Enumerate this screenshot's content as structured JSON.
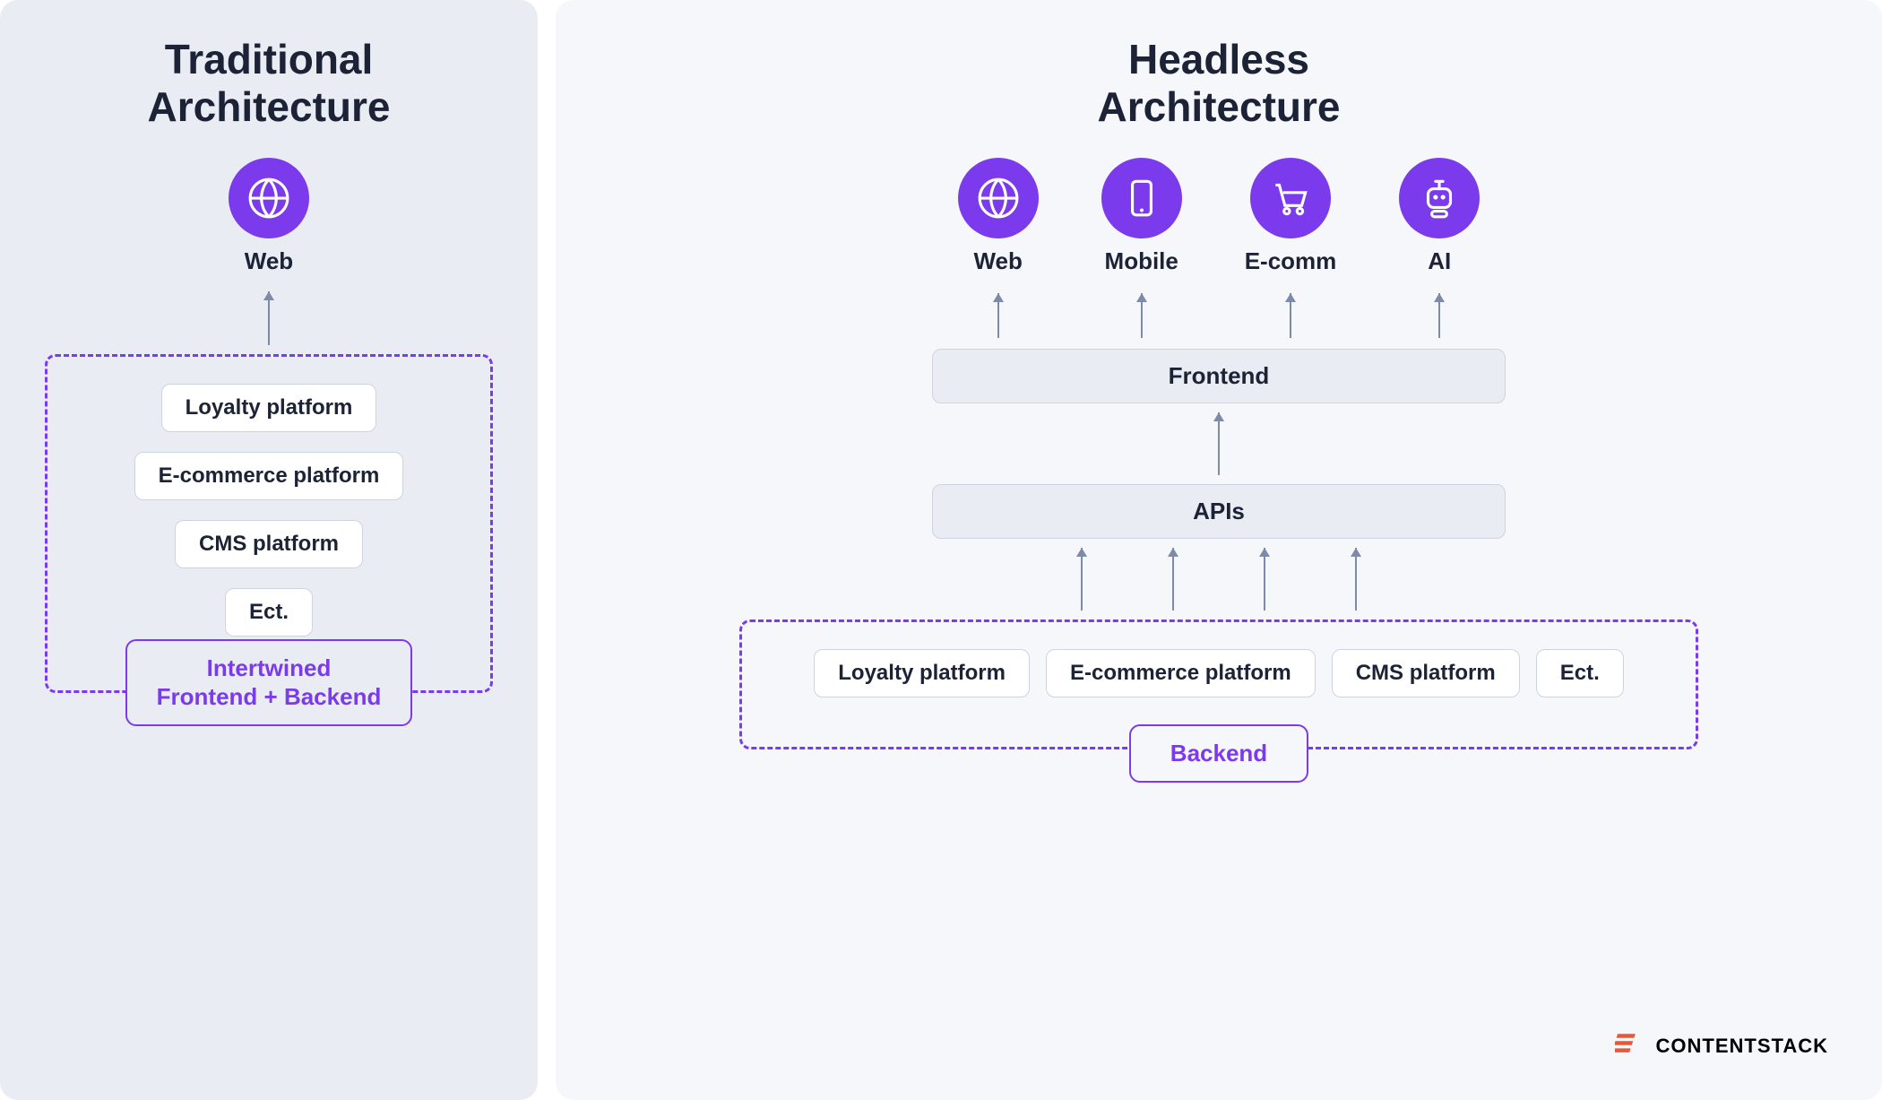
{
  "traditional": {
    "title_line1": "Traditional",
    "title_line2": "Architecture",
    "channel": {
      "name": "Web",
      "icon": "globe"
    },
    "stack": [
      "Loyalty platform",
      "E-commerce platform",
      "CMS platform",
      "Ect."
    ],
    "box_label_line1": "Intertwined",
    "box_label_line2": "Frontend + Backend"
  },
  "headless": {
    "title_line1": "Headless",
    "title_line2": "Architecture",
    "channels": [
      {
        "name": "Web",
        "icon": "globe"
      },
      {
        "name": "Mobile",
        "icon": "mobile"
      },
      {
        "name": "E-comm",
        "icon": "cart"
      },
      {
        "name": "AI",
        "icon": "robot"
      }
    ],
    "frontend_label": "Frontend",
    "apis_label": "APIs",
    "backend_services": [
      "Loyalty platform",
      "E-commerce platform",
      "CMS platform",
      "Ect."
    ],
    "backend_label": "Backend"
  },
  "brand": {
    "name": "CONTENTSTACK"
  },
  "colors": {
    "accent": "#7c3aed",
    "text": "#1c2336",
    "left_bg": "#e9ecf2",
    "right_bg": "#f5f7fb",
    "brand": "#eb5634"
  }
}
